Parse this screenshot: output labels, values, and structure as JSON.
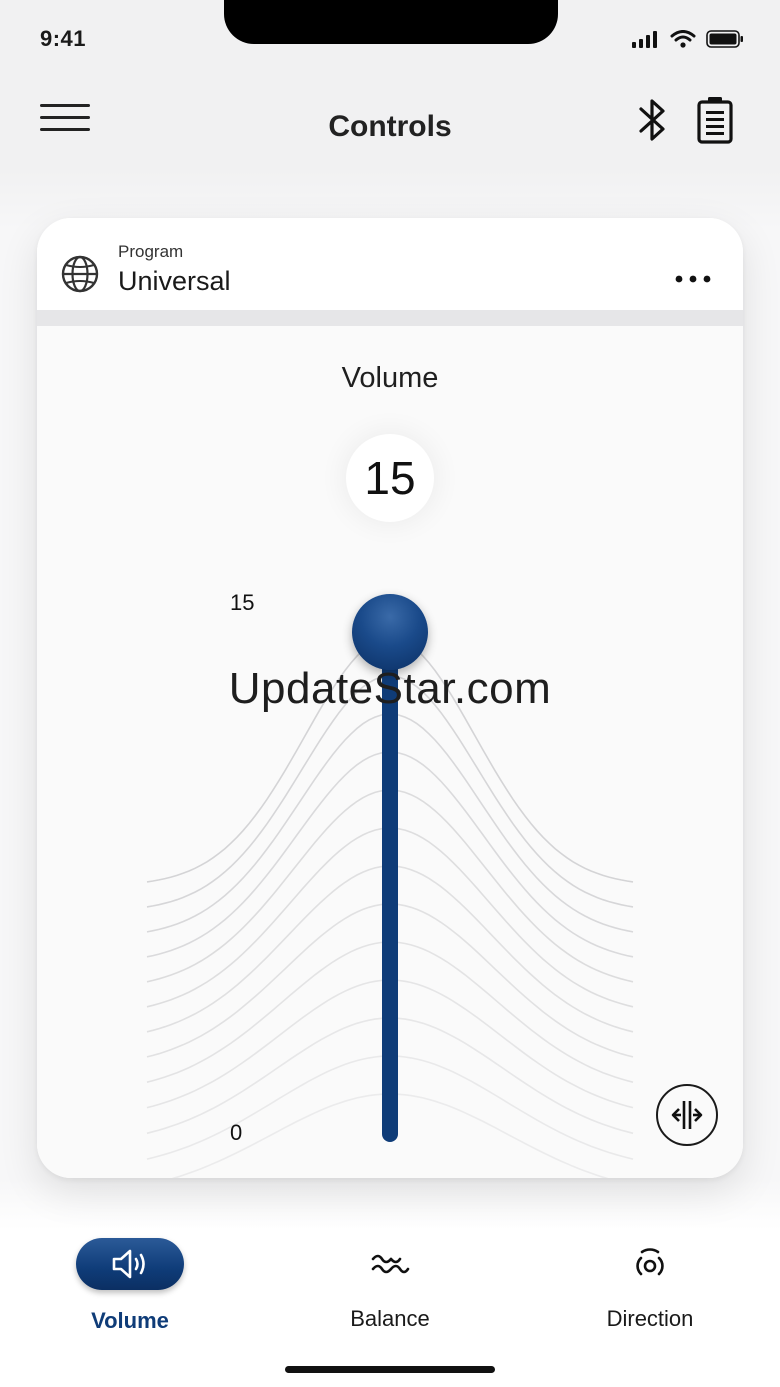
{
  "status_bar": {
    "time": "9:41"
  },
  "header": {
    "title": "Controls",
    "menu_icon": "hamburger-icon",
    "bluetooth_icon": "bluetooth-icon",
    "battery_icon": "battery-icon"
  },
  "program": {
    "label": "Program",
    "value": "Universal",
    "icon": "globe-icon",
    "more_icon": "more-icon"
  },
  "volume": {
    "title": "Volume",
    "current": "15",
    "max_label": "15",
    "min_label": "0",
    "level": 1.0,
    "split_icon": "split-icon"
  },
  "watermark": "UpdateStar.com",
  "tabs": [
    {
      "label": "Volume",
      "icon": "speaker-icon",
      "active": true
    },
    {
      "label": "Balance",
      "icon": "balance-icon",
      "active": false
    },
    {
      "label": "Direction",
      "icon": "direction-icon",
      "active": false
    }
  ],
  "colors": {
    "accent": "#0f3c78",
    "background": "#f1f1f2",
    "card": "#ffffff"
  }
}
